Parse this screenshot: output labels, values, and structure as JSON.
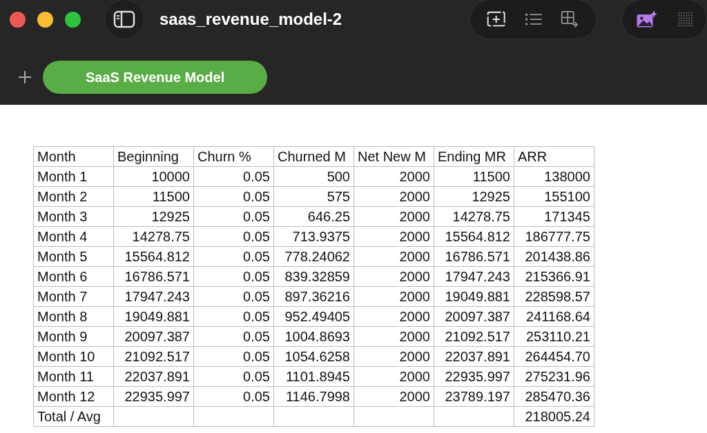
{
  "window": {
    "title": "saas_revenue_model-2"
  },
  "sheets": [
    {
      "label": "SaaS Revenue Model",
      "selected": true
    }
  ],
  "table": {
    "columns": [
      "Month",
      "Beginning",
      "Churn %",
      "Churned M",
      "Net New M",
      "Ending MR",
      "ARR"
    ],
    "rows": [
      [
        "Month 1",
        "10000",
        "0.05",
        "500",
        "2000",
        "11500",
        "138000"
      ],
      [
        "Month 2",
        "11500",
        "0.05",
        "575",
        "2000",
        "12925",
        "155100"
      ],
      [
        "Month 3",
        "12925",
        "0.05",
        "646.25",
        "2000",
        "14278.75",
        "171345"
      ],
      [
        "Month 4",
        "14278.75",
        "0.05",
        "713.9375",
        "2000",
        "15564.812",
        "186777.75"
      ],
      [
        "Month 5",
        "15564.812",
        "0.05",
        "778.24062",
        "2000",
        "16786.571",
        "201438.86"
      ],
      [
        "Month 6",
        "16786.571",
        "0.05",
        "839.32859",
        "2000",
        "17947.243",
        "215366.91"
      ],
      [
        "Month 7",
        "17947.243",
        "0.05",
        "897.36216",
        "2000",
        "19049.881",
        "228598.57"
      ],
      [
        "Month 8",
        "19049.881",
        "0.05",
        "952.49405",
        "2000",
        "20097.387",
        "241168.64"
      ],
      [
        "Month 9",
        "20097.387",
        "0.05",
        "1004.8693",
        "2000",
        "21092.517",
        "253110.21"
      ],
      [
        "Month 10",
        "21092.517",
        "0.05",
        "1054.6258",
        "2000",
        "22037.891",
        "264454.70"
      ],
      [
        "Month 11",
        "22037.891",
        "0.05",
        "1101.8945",
        "2000",
        "22935.997",
        "275231.96"
      ],
      [
        "Month 12",
        "22935.997",
        "0.05",
        "1146.7998",
        "2000",
        "23789.197",
        "285470.36"
      ],
      [
        "Total / Avg",
        "",
        "",
        "",
        "",
        "",
        "218005.24"
      ]
    ]
  }
}
